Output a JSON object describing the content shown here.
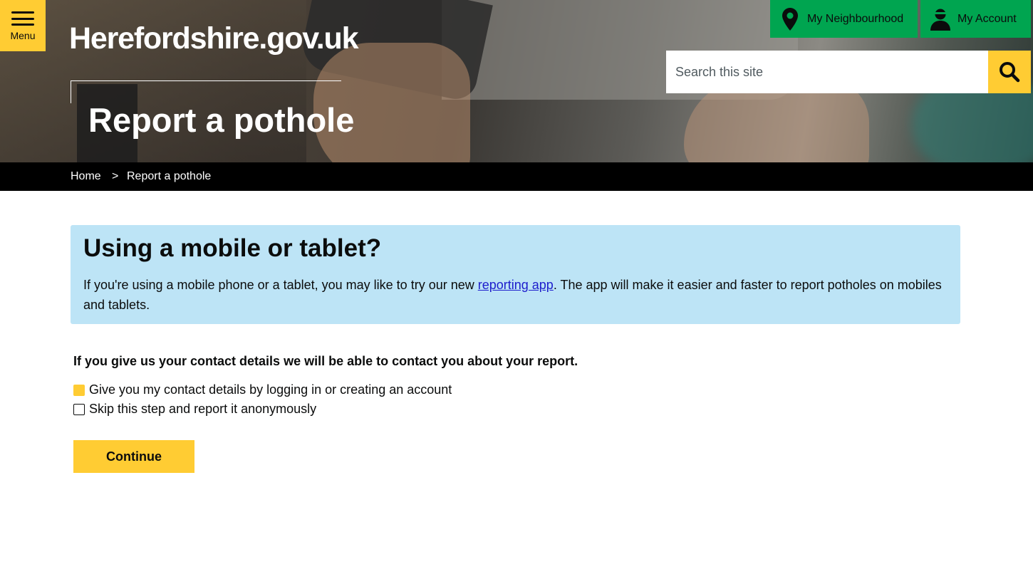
{
  "header": {
    "menu_label": "Menu",
    "logo_text": "Herefordshire.gov.uk",
    "page_title": "Report a pothole",
    "my_neighbourhood_label": "My Neighbourhood",
    "my_account_label": "My Account",
    "search": {
      "placeholder": "Search this site",
      "value": ""
    }
  },
  "breadcrumb": {
    "items": [
      {
        "label": "Home"
      },
      {
        "label": "Report a pothole"
      }
    ],
    "separator": ">"
  },
  "notice": {
    "title": "Using a mobile or tablet?",
    "text_before_link": "If you're using a mobile phone or a tablet, you may like to try our new ",
    "link_text": "reporting app",
    "text_after_link": ". The app will make it easier and faster to report potholes on mobiles and tablets."
  },
  "form": {
    "prompt": "If you give us your contact details we will be able to contact you about your report.",
    "options": [
      {
        "label": "Give you my contact details by logging in or creating an account",
        "selected": true
      },
      {
        "label": "Skip this step and report it anonymously",
        "selected": false
      }
    ],
    "continue_label": "Continue"
  },
  "colors": {
    "accent_yellow": "#ffcc33",
    "nav_green": "#00a550",
    "notice_blue": "#bde4f6",
    "breadcrumb_black": "#000000",
    "link_blue": "#1d1dcc"
  },
  "icons": [
    "menu-icon",
    "location-pin-icon",
    "user-icon",
    "search-icon"
  ]
}
